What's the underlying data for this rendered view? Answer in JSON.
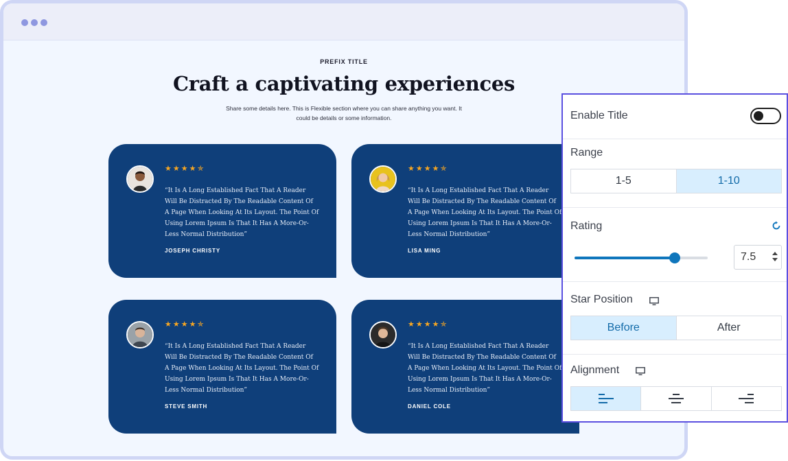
{
  "page": {
    "prefix": "PREFIX TITLE",
    "headline": "Craft a captivating experiences",
    "subtext": "Share some details here. This is Flexible section where you can share anything you want. It could be details or some information."
  },
  "testimonials": [
    {
      "stars": "★★★★✯",
      "quote": "“It Is A Long Established Fact That A Reader Will Be Distracted By The Readable Content Of A Page When Looking At Its Layout. The Point Of Using Lorem Ipsum Is That It Has A More-Or-Less Normal Distribution”",
      "author": "JOSEPH CHRISTY"
    },
    {
      "stars": "★★★★✯",
      "quote": "“It Is A Long Established Fact That A Reader Will Be Distracted By The Readable Content Of A Page When Looking At Its Layout. The Point Of Using Lorem Ipsum Is That It Has A More-Or-Less Normal Distribution”",
      "author": "LISA MING"
    },
    {
      "stars": "★★★★✯",
      "quote": "“It Is A Long Established Fact That A Reader Will Be Distracted By The Readable Content Of A Page When Looking At Its Layout. The Point Of Using Lorem Ipsum Is That It Has A More-Or-Less Normal Distribution”",
      "author": "STEVE SMITH"
    },
    {
      "stars": "★★★★✯",
      "quote": "“It Is A Long Established Fact That A Reader Will Be Distracted By The Readable Content Of A Page When Looking At Its Layout. The Point Of Using Lorem Ipsum Is That It Has A More-Or-Less Normal Distribution”",
      "author": "DANIEL COLE"
    }
  ],
  "panel": {
    "enable_title_label": "Enable Title",
    "enable_title_on": false,
    "range_label": "Range",
    "range_options": [
      "1-5",
      "1-10"
    ],
    "range_selected": "1-10",
    "rating_label": "Rating",
    "rating_value": "7.5",
    "rating_max": 10,
    "star_position_label": "Star Position",
    "star_position_options": [
      "Before",
      "After"
    ],
    "star_position_selected": "Before",
    "alignment_label": "Alignment",
    "alignment_options": [
      "left",
      "center",
      "right"
    ],
    "alignment_selected": "left",
    "icons": [
      "reset-icon",
      "desktop-icon",
      "align-left-icon",
      "align-center-icon",
      "align-right-icon"
    ]
  },
  "colors": {
    "card": "#0f3f7a",
    "star": "#f6a623",
    "accent": "#0f76bc",
    "panel_border": "#5a4fe0",
    "active_segment": "#d8eefe"
  }
}
